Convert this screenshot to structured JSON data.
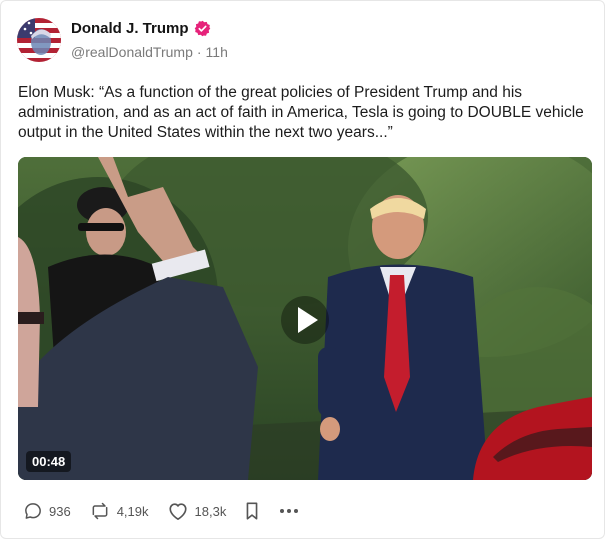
{
  "post": {
    "author": {
      "display_name": "Donald J. Trump",
      "handle": "@realDonaldTrump",
      "separator": "·",
      "time_ago": "11h",
      "verified": true,
      "verified_color": "#e6227a"
    },
    "text": "Elon Musk: “As a function of the great policies of President Trump and his administration, and as an act of faith in America, Tesla is going to DOUBLE vehicle output in the United States within the next two years...”",
    "media": {
      "type": "video",
      "duration": "00:48"
    },
    "actions": {
      "replies": {
        "count": "936",
        "icon": "reply-icon"
      },
      "reposts": {
        "count": "4,19k",
        "icon": "repost-icon"
      },
      "likes": {
        "count": "18,3k",
        "icon": "heart-icon"
      },
      "bookmark": {
        "icon": "bookmark-icon"
      },
      "more": {
        "icon": "more-icon"
      }
    }
  }
}
